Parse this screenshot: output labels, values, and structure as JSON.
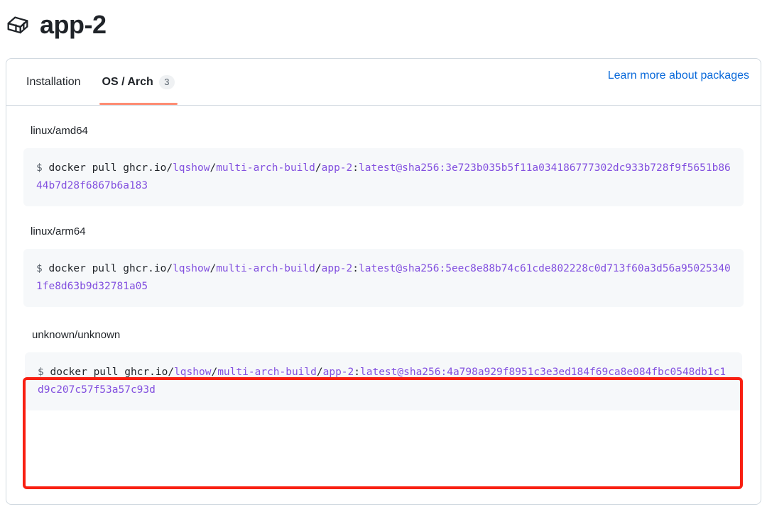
{
  "header": {
    "icon": "package-box-icon",
    "title": "app-2"
  },
  "tabs": [
    {
      "id": "installation",
      "label": "Installation",
      "active": false,
      "counter": null
    },
    {
      "id": "os-arch",
      "label": "OS / Arch",
      "active": true,
      "counter": "3"
    }
  ],
  "tabbar": {
    "learn_more_label": "Learn more about packages"
  },
  "variants": [
    {
      "arch": "linux/amd64",
      "highlighted": false,
      "command": {
        "prompt": "$",
        "cmd": " docker pull ghcr.io/",
        "owner": "lqshow",
        "sep1": "/",
        "repo": "multi-arch-build",
        "sep2": "/",
        "image": "app-2",
        "tag_sep": ":",
        "tag": "latest@sha256:3e723b035b5f11a034186777302dc933b728f9f5651b8644b7d28f6867b6a183",
        "full": "$ docker pull ghcr.io/lqshow/multi-arch-build/app-2:latest@sha256:3e723b035b5f11a034186777302dc933b728f9f5651b8644b7d28f6867b6a183"
      }
    },
    {
      "arch": "linux/arm64",
      "highlighted": false,
      "command": {
        "prompt": "$",
        "cmd": " docker pull ghcr.io/",
        "owner": "lqshow",
        "sep1": "/",
        "repo": "multi-arch-build",
        "sep2": "/",
        "image": "app-2",
        "tag_sep": ":",
        "tag": "latest@sha256:5eec8e88b74c61cde802228c0d713f60a3d56a950253401fe8d63b9d32781a05",
        "full": "$ docker pull ghcr.io/lqshow/multi-arch-build/app-2:latest@sha256:5eec8e88b74c61cde802228c0d713f60a3d56a950253401fe8d63b9d32781a05"
      }
    },
    {
      "arch": "unknown/unknown",
      "highlighted": true,
      "command": {
        "prompt": "$",
        "cmd": " docker pull ghcr.io/",
        "owner": "lqshow",
        "sep1": "/",
        "repo": "multi-arch-build",
        "sep2": "/",
        "image": "app-2",
        "tag_sep": ":",
        "tag": "latest@sha256:4a798a929f8951c3e3ed184f69ca8e084fbc0548db1c1d9c207c57f53a57c93d",
        "full": "$ docker pull ghcr.io/lqshow/multi-arch-build/app-2:latest@sha256:4a798a929f8951c3e3ed184f69ca8e084fbc0548db1c1d9c207c57f53a57c93d"
      }
    }
  ],
  "annotation": {
    "name": "red-highlight-box",
    "color": "#f81f12",
    "target": "unknown/unknown"
  },
  "colors": {
    "accent_link": "#0969da",
    "tab_underline": "#fd8c73",
    "code_token": "#8250df",
    "code_bg": "#f6f8fa",
    "border": "#d1d9e0",
    "annotation": "#f81f12"
  }
}
